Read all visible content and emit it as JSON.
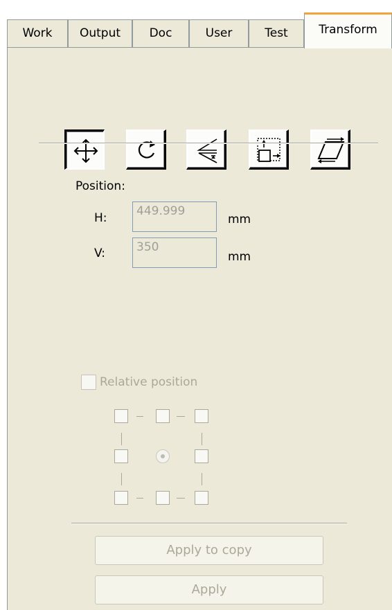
{
  "tabs": [
    {
      "label": "Work",
      "active": false
    },
    {
      "label": "Output",
      "active": false
    },
    {
      "label": "Doc",
      "active": false
    },
    {
      "label": "User",
      "active": false
    },
    {
      "label": "Test",
      "active": false
    },
    {
      "label": "Transform",
      "active": true
    }
  ],
  "toolbar": {
    "tools": [
      {
        "icon": "move-icon",
        "pressed": true
      },
      {
        "icon": "rotate-icon",
        "pressed": false
      },
      {
        "icon": "mirror-icon",
        "pressed": false
      },
      {
        "icon": "scale-icon",
        "pressed": false
      },
      {
        "icon": "skew-icon",
        "pressed": false
      }
    ]
  },
  "position": {
    "title": "Position:",
    "h_label": "H:",
    "h_value": "449.999",
    "h_unit": "mm",
    "v_label": "V:",
    "v_value": "350",
    "v_unit": "mm"
  },
  "relative": {
    "label": "Relative position",
    "checked": false,
    "enabled": false
  },
  "buttons": {
    "apply_to_copy": "Apply to copy",
    "apply": "Apply"
  },
  "colors": {
    "panel_bg": "#ece9d8",
    "active_tab_accent": "#f1a43c",
    "disabled_text": "#aca899",
    "field_border": "#7f9db9"
  }
}
